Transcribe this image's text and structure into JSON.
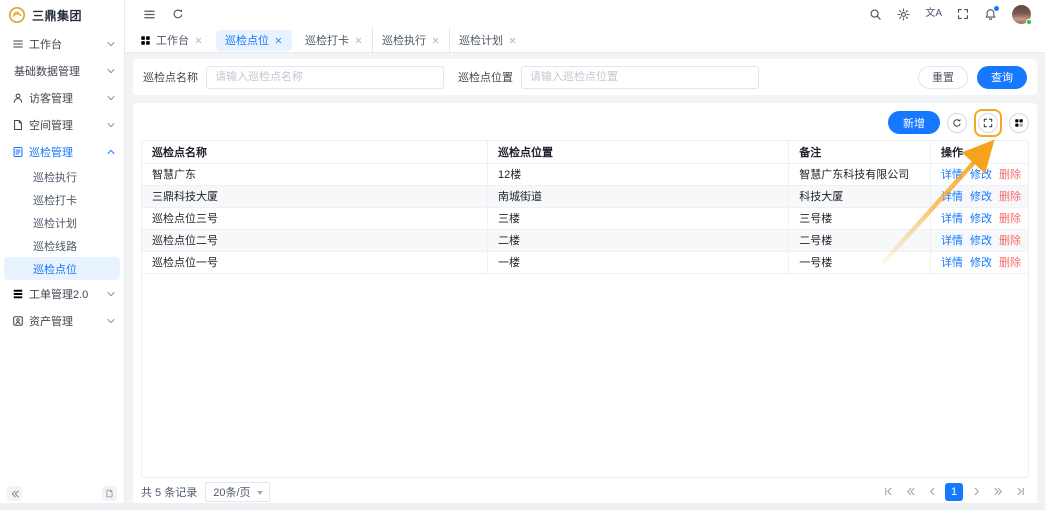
{
  "brand": {
    "company_name": "三鼎集团"
  },
  "header": {
    "translate_glyph": "文A",
    "icons": [
      "menu-collapse-icon",
      "refresh-icon",
      "search-icon",
      "settings-icon",
      "translate-icon",
      "fullscreen-icon",
      "notification-icon",
      "avatar"
    ]
  },
  "sidebar": {
    "items": [
      {
        "label": "工作台"
      },
      {
        "label": "基础数据管理"
      },
      {
        "label": "访客管理"
      },
      {
        "label": "空间管理"
      },
      {
        "label": "巡检管理"
      },
      {
        "label": "巡检执行"
      },
      {
        "label": "巡检打卡"
      },
      {
        "label": "巡检计划"
      },
      {
        "label": "巡检线路"
      },
      {
        "label": "巡检点位"
      },
      {
        "label": "工单管理2.0"
      },
      {
        "label": "资产管理"
      }
    ]
  },
  "tabs": {
    "items": [
      {
        "label": "工作台"
      },
      {
        "label": "巡检点位"
      },
      {
        "label": "巡检打卡"
      },
      {
        "label": "巡检执行"
      },
      {
        "label": "巡检计划"
      }
    ]
  },
  "search": {
    "name_label": "巡检点名称",
    "name_placeholder": "请输入巡检点名称",
    "location_label": "巡检点位置",
    "location_placeholder": "请输入巡检点位置",
    "reset_label": "重置",
    "query_label": "查询"
  },
  "toolbar": {
    "add_label": "新增",
    "icon_buttons": [
      "refresh-icon",
      "fullscreen-table-icon",
      "column-settings-icon"
    ]
  },
  "table": {
    "columns": [
      "巡检点名称",
      "巡检点位置",
      "备注",
      "操作"
    ],
    "rows": [
      {
        "name": "智慧广东",
        "location": "12楼",
        "remark": "智慧广东科技有限公司"
      },
      {
        "name": "三鼎科技大厦",
        "location": "南城街道",
        "remark": "科技大厦"
      },
      {
        "name": "巡检点位三号",
        "location": "三楼",
        "remark": "三号楼"
      },
      {
        "name": "巡检点位二号",
        "location": "二楼",
        "remark": "二号楼"
      },
      {
        "name": "巡检点位一号",
        "location": "一楼",
        "remark": "一号楼"
      }
    ],
    "action_labels": {
      "detail": "详情",
      "edit": "修改",
      "delete": "删除"
    }
  },
  "pagination": {
    "total_text": "共 5 条记录",
    "page_size_text": "20条/页",
    "current_page": "1"
  },
  "annotation": {
    "type": "orange arrow + highlight box",
    "target": "fullscreen-table-icon",
    "color": "#f5a31e"
  },
  "colors": {
    "primary": "#1677ff",
    "danger": "#f56c6c",
    "annotation_orange": "#f5a31e",
    "active_item_bg": "#e8f3ff"
  }
}
